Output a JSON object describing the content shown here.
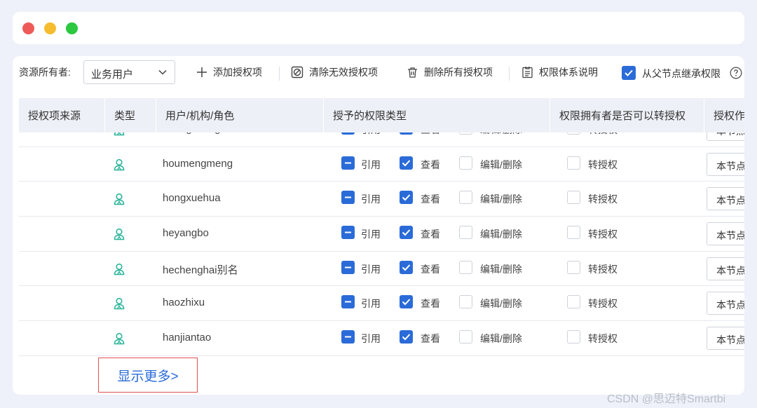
{
  "window": {
    "controls": [
      "close",
      "minimize",
      "maximize"
    ]
  },
  "toolbar": {
    "owner_label": "资源所有者:",
    "owner_value": "业务用户",
    "add": "添加授权项",
    "clear": "清除无效授权项",
    "delete_all": "删除所有授权项",
    "doc": "权限体系说明",
    "inherit": "从父节点继承权限",
    "inherit_checked": true
  },
  "table": {
    "headers": [
      "授权项来源",
      "类型",
      "用户/机构/角色",
      "授予的权限类型",
      "权限拥有者是否可以转授权",
      "授权作"
    ],
    "perm_labels": {
      "ref": "引用",
      "view": "查看",
      "edit": "编辑/删除",
      "grant": "转授权"
    },
    "action_label": "本节点",
    "rows": [
      {
        "name": "huangchang"
      },
      {
        "name": "houmengmeng"
      },
      {
        "name": "hongxuehua"
      },
      {
        "name": "heyangbo"
      },
      {
        "name": "hechenghai别名"
      },
      {
        "name": "haozhixu"
      },
      {
        "name": "hanjiantao"
      }
    ]
  },
  "show_more": "显示更多>",
  "watermark": "CSDN @思迈特Smartbi",
  "colors": {
    "accent": "#2a6bd8",
    "user_icon": "#2bb59a",
    "highlight_border": "#e05050"
  }
}
